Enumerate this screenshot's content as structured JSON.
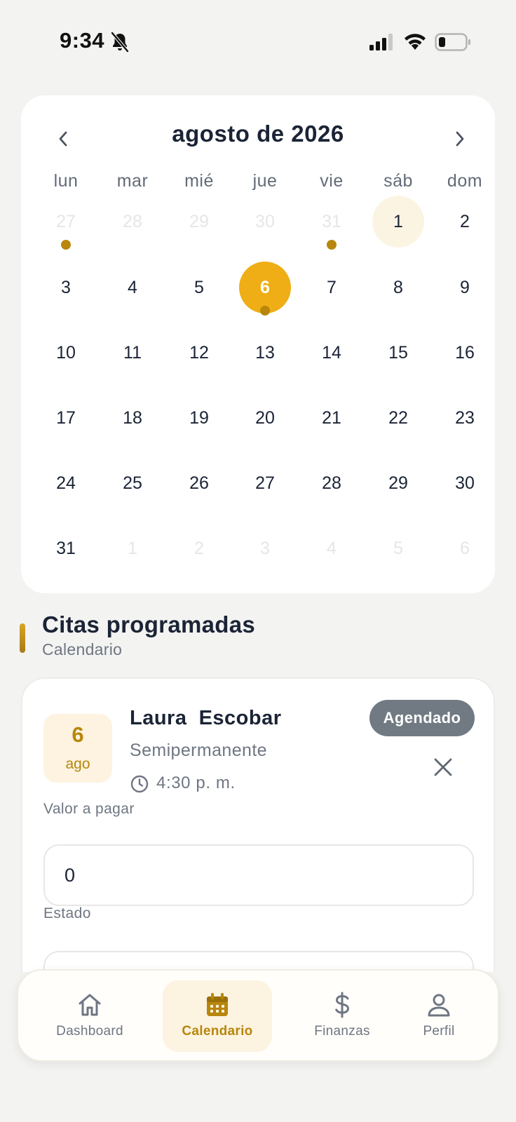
{
  "status_bar": {
    "time": "9:34",
    "icons": [
      "bell-slash-icon",
      "signal-icon",
      "wifi-icon",
      "battery-icon"
    ]
  },
  "calendar": {
    "month_title": "agosto de 2026",
    "weekdays": [
      "lun",
      "mar",
      "mié",
      "jue",
      "vie",
      "sáb",
      "dom"
    ],
    "weeks": [
      [
        {
          "d": "27",
          "muted": true,
          "dot": true
        },
        {
          "d": "28",
          "muted": true
        },
        {
          "d": "29",
          "muted": true
        },
        {
          "d": "30",
          "muted": true
        },
        {
          "d": "31",
          "muted": true,
          "dot": true
        },
        {
          "d": "1",
          "today": true
        },
        {
          "d": "2"
        }
      ],
      [
        {
          "d": "3"
        },
        {
          "d": "4"
        },
        {
          "d": "5"
        },
        {
          "d": "6",
          "selected": true,
          "dot": true
        },
        {
          "d": "7"
        },
        {
          "d": "8"
        },
        {
          "d": "9"
        }
      ],
      [
        {
          "d": "10"
        },
        {
          "d": "11"
        },
        {
          "d": "12"
        },
        {
          "d": "13"
        },
        {
          "d": "14"
        },
        {
          "d": "15"
        },
        {
          "d": "16"
        }
      ],
      [
        {
          "d": "17"
        },
        {
          "d": "18"
        },
        {
          "d": "19"
        },
        {
          "d": "20"
        },
        {
          "d": "21"
        },
        {
          "d": "22"
        },
        {
          "d": "23"
        }
      ],
      [
        {
          "d": "24"
        },
        {
          "d": "25"
        },
        {
          "d": "26"
        },
        {
          "d": "27"
        },
        {
          "d": "28"
        },
        {
          "d": "29"
        },
        {
          "d": "30"
        }
      ],
      [
        {
          "d": "31"
        },
        {
          "d": "1",
          "muted": true
        },
        {
          "d": "2",
          "muted": true
        },
        {
          "d": "3",
          "muted": true
        },
        {
          "d": "4",
          "muted": true
        },
        {
          "d": "5",
          "muted": true
        },
        {
          "d": "6",
          "muted": true
        }
      ]
    ]
  },
  "section": {
    "title": "Citas programadas",
    "subtitle": "Calendario"
  },
  "appointment": {
    "day": "6",
    "month": "ago",
    "client_name": "Laura  Escobar",
    "service": "Semipermanente",
    "time": "4:30 p. m.",
    "status": "Agendado",
    "value_label": "Valor a pagar",
    "value": "0",
    "estado_label": "Estado"
  },
  "bottom_nav": {
    "items": [
      {
        "label": "Dashboard",
        "icon": "home-icon",
        "active": false
      },
      {
        "label": "Calendario",
        "icon": "calendar-icon",
        "active": true
      },
      {
        "label": "Finanzas",
        "icon": "dollar-icon",
        "active": false
      },
      {
        "label": "Perfil",
        "icon": "user-icon",
        "active": false
      }
    ]
  },
  "colors": {
    "accent": "#efae15",
    "accent_dark": "#b8860b",
    "accent_soft": "#fcf4e3",
    "status_badge": "#717a83"
  }
}
